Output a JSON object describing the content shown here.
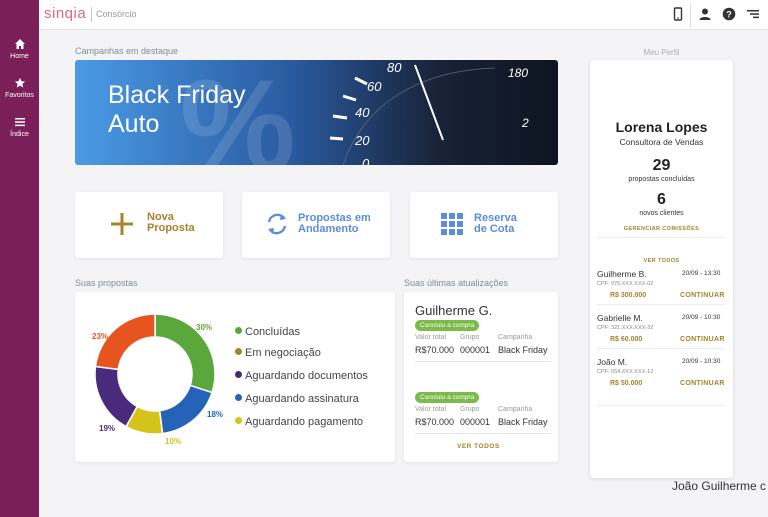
{
  "brand": {
    "logo": "sinqia",
    "product": "Consórcio",
    "accent": "#7a1f58"
  },
  "sidebar": {
    "items": [
      {
        "label": "Home",
        "icon": "home-icon"
      },
      {
        "label": "Favoritos",
        "icon": "star-icon"
      },
      {
        "label": "Índice",
        "icon": "menu-icon"
      }
    ]
  },
  "topbar": {
    "icons": [
      "mobile-icon",
      "user-icon",
      "help-icon",
      "menu-icon"
    ]
  },
  "campaigns": {
    "title": "Campanhas em destaque",
    "banner": {
      "line1": "Black Friday",
      "line2": "Auto",
      "speedo": [
        "80",
        "60",
        "40",
        "20",
        "0",
        "180",
        "2"
      ]
    }
  },
  "actions": [
    {
      "line1": "Nova",
      "line2": "Proposta",
      "icon": "plus-icon",
      "color": "#a8822d"
    },
    {
      "line1": "Propostas em",
      "line2": "Andamento",
      "icon": "sync-icon",
      "color": "#5b8dd9"
    },
    {
      "line1": "Reserva",
      "line2": "de Cota",
      "icon": "grid-icon",
      "color": "#5b8dd9"
    }
  ],
  "proposals": {
    "title": "Suas propostas",
    "legend": [
      {
        "label": "Concluídas",
        "color": "#5aa83c"
      },
      {
        "label": "Em negociação",
        "color": "#a8822d"
      },
      {
        "label": "Aguardando documentos",
        "color": "#4a2a7d"
      },
      {
        "label": "Aguardando assinatura",
        "color": "#2563b8"
      },
      {
        "label": "Aguardando pagamento",
        "color": "#d4c41a"
      }
    ]
  },
  "chart_data": {
    "type": "pie",
    "categories": [
      "Concluídas",
      "Aguardando assinatura",
      "Aguardando pagamento",
      "Em negociação",
      "Aguardando documentos",
      "Em negociação (23%)"
    ],
    "values": [
      30,
      18,
      10,
      0,
      19,
      23
    ],
    "labels": [
      "30%",
      "18%",
      "10%",
      "",
      "19%",
      "23%"
    ],
    "colors": [
      "#5aa83c",
      "#2563b8",
      "#d4c41a",
      "#e8541f",
      "#4a2a7d",
      "#e8541f"
    ]
  },
  "updates": {
    "title": "Suas últimas atualizações",
    "name": "Guilherme G.",
    "items": [
      {
        "badge": "Concluiu a compra",
        "total_label": "Valor total",
        "total": "R$70.000",
        "group_label": "Grupo",
        "group": "000001",
        "campaign_label": "Campanha",
        "campaign": "Black Friday"
      },
      {
        "badge": "Concluiu a compra",
        "total_label": "Valor total",
        "total": "R$70.000",
        "group_label": "Grupo",
        "group": "000001",
        "campaign_label": "Campanha",
        "campaign": "Black Friday"
      }
    ],
    "see_all": "VER TODOS"
  },
  "profile": {
    "title": "Meu Perfil",
    "name": "Lorena Lopes",
    "role": "Consultora de Vendas",
    "stat1": {
      "value": "29",
      "label": "propostas concluídas"
    },
    "stat2": {
      "value": "6",
      "label": "novos clientes"
    },
    "manage": "GERENCIAR COMISSÕES",
    "see_all": "VER TODOS",
    "clients": [
      {
        "name": "Guilherme B.",
        "cpf": "CPF: 976.XXX.XXX-02",
        "date": "20/09 - 13:30",
        "value": "R$ 300.000",
        "action": "CONTINUAR"
      },
      {
        "name": "Gabrielle M.",
        "cpf": "CPF: 321.XXX.XXX-32",
        "date": "20/09 - 10:30",
        "value": "R$ 60.000",
        "action": "CONTINUAR"
      },
      {
        "name": "João M.",
        "cpf": "CPF: 654.XXX.XXX-12",
        "date": "20/09 - 10:30",
        "value": "R$ 50.000",
        "action": "CONTINUAR"
      }
    ]
  },
  "footer": {
    "name": "João Guilherme c"
  }
}
